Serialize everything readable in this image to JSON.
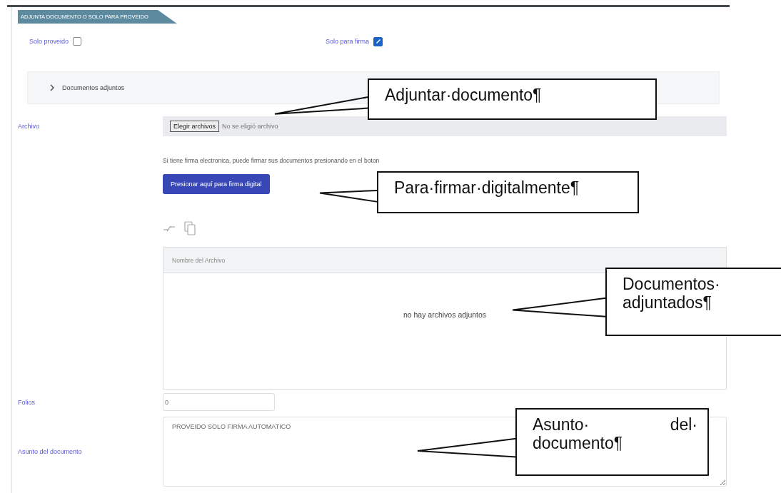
{
  "section": {
    "title": "ADJUNTA DOCUMENTO O SOLO PARA PROVEIDO"
  },
  "options": [
    {
      "label": "Solo proveido",
      "checked": false
    },
    {
      "label": "Solo para firma",
      "checked": true
    }
  ],
  "accordion": {
    "label": "Documentos adjuntos",
    "expanded": false
  },
  "file_field": {
    "label": "Archivo",
    "button": "Elegir archivos",
    "status": "No se eligió archivo"
  },
  "sign_hint": "Si tiene firma electronica, puede firmar sus documentos presionando en el boton",
  "sign_button": "Presionar aquí para firma digital",
  "table": {
    "columns": [
      "Nombre del Archivo"
    ],
    "empty_message": "no hay archivos adjuntos"
  },
  "folios": {
    "label": "Folios",
    "value": "0"
  },
  "subject": {
    "label": "Asunto del documento",
    "value": "PROVEIDO SOLO FIRMA AUTOMATICO"
  },
  "callouts": [
    {
      "text": "Adjuntar·documento¶"
    },
    {
      "text": "Para·firmar·digitalmente¶"
    },
    {
      "text": "Documentos· adjuntados¶"
    },
    {
      "text": "Asunto· del· documento¶"
    }
  ]
}
